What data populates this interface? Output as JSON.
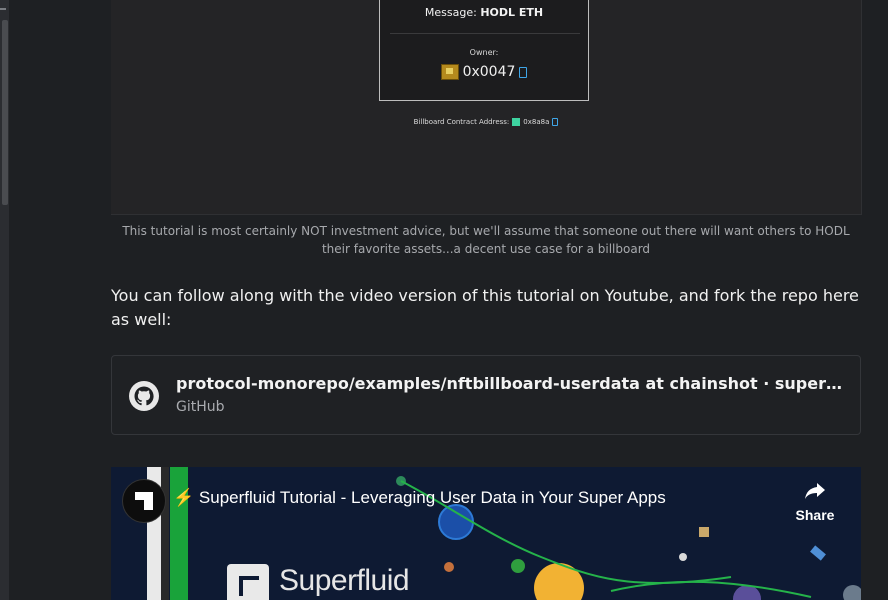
{
  "billboard": {
    "message_label": "Message:",
    "message_value": "HODL ETH",
    "owner_label": "Owner:",
    "owner_address": "0x0047",
    "contract_label": "Billboard Contract Address:",
    "contract_address": "0x8a8a"
  },
  "caption": "This tutorial is most certainly NOT investment advice, but we'll assume that someone out there will want others to HODL their favorite assets...a decent use case for a billboard",
  "paragraph": "You can follow along with the video version of this tutorial on Youtube, and fork the repo here as well:",
  "link_card": {
    "title": "protocol-monorepo/examples/nftbillboard-userdata at chainshot · superfluid-finance/protocol-monorepo",
    "source": "GitHub",
    "icon": "github-icon"
  },
  "video": {
    "title": "Superfluid Tutorial - Leveraging User Data in Your Super Apps",
    "title_prefix": "⚡",
    "share_label": "Share",
    "brand_text": "Superfluid"
  },
  "colors": {
    "background": "#1e2023",
    "accent_copy": "#3fa6e8",
    "stripe_green": "#19a33a",
    "video_bg": "#0e1a33"
  }
}
